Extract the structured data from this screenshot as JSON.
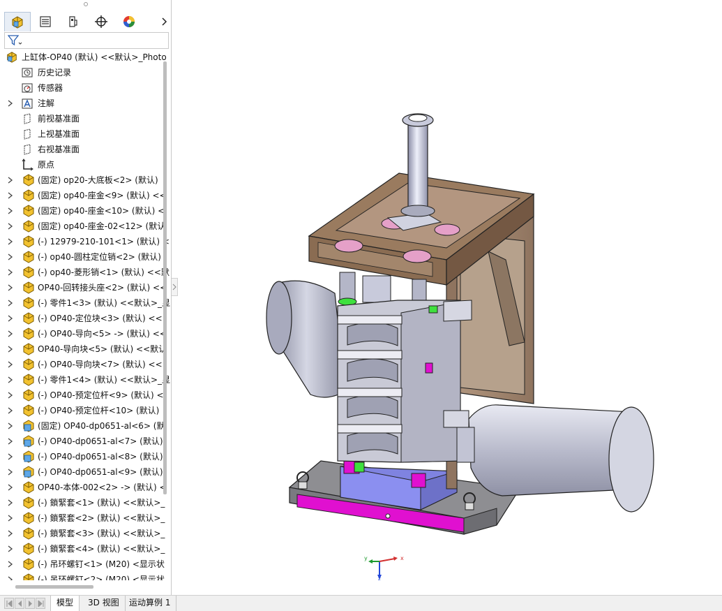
{
  "tree": {
    "root": "上缸体-OP40 (默认) <<默认>_Photo",
    "items": [
      {
        "label": "历史记录",
        "icon": "history-icon",
        "arrow": false
      },
      {
        "label": "传感器",
        "icon": "sensor-icon",
        "arrow": false
      },
      {
        "label": "注解",
        "icon": "annotation-icon",
        "arrow": true
      },
      {
        "label": "前视基准面",
        "icon": "plane-icon",
        "arrow": false
      },
      {
        "label": "上视基准面",
        "icon": "plane-icon",
        "arrow": false
      },
      {
        "label": "右视基准面",
        "icon": "plane-icon",
        "arrow": false
      },
      {
        "label": "原点",
        "icon": "origin-icon",
        "arrow": false
      },
      {
        "label": "(固定) op20-大底板<2> (默认)",
        "icon": "part-icon",
        "arrow": true
      },
      {
        "label": "(固定) op40-座金<9> (默认) <<",
        "icon": "part-icon",
        "arrow": true
      },
      {
        "label": "(固定) op40-座金<10> (默认) <",
        "icon": "part-icon",
        "arrow": true
      },
      {
        "label": "(固定) op40-座金-02<12> (默认",
        "icon": "part-icon",
        "arrow": true
      },
      {
        "label": "(-) 12979-210-101<1> (默认) <",
        "icon": "part-icon",
        "arrow": true
      },
      {
        "label": "(-) op40-圆柱定位销<2> (默认)",
        "icon": "part-icon",
        "arrow": true
      },
      {
        "label": "(-) op40-菱形销<1> (默认) <<默",
        "icon": "part-icon",
        "arrow": true
      },
      {
        "label": "OP40-回转接头座<2> (默认) <<",
        "icon": "part-icon",
        "arrow": true
      },
      {
        "label": "(-) 零件1<3> (默认) <<默认>_显",
        "icon": "part-icon",
        "arrow": true
      },
      {
        "label": "(-) OP40-定位块<3> (默认) <<",
        "icon": "part-icon",
        "arrow": true
      },
      {
        "label": "(-) OP40-导向<5> -> (默认) <<",
        "icon": "part-icon",
        "arrow": true
      },
      {
        "label": "OP40-导向块<5> (默认) <<默认",
        "icon": "part-icon",
        "arrow": true
      },
      {
        "label": "(-) OP40-导向块<7> (默认) <<",
        "icon": "part-icon",
        "arrow": true
      },
      {
        "label": "(-) 零件1<4> (默认) <<默认>_显",
        "icon": "part-icon",
        "arrow": true
      },
      {
        "label": "(-) OP40-预定位杆<9> (默认) <",
        "icon": "part-icon",
        "arrow": true
      },
      {
        "label": "(-) OP40-预定位杆<10> (默认)",
        "icon": "part-icon",
        "arrow": true
      },
      {
        "label": "(固定) OP40-dp0651-al<6> (默",
        "icon": "assembly-icon",
        "arrow": true
      },
      {
        "label": "(-) OP40-dp0651-al<7> (默认)",
        "icon": "assembly-icon",
        "arrow": true
      },
      {
        "label": "(-) OP40-dp0651-al<8> (默认)",
        "icon": "assembly-icon",
        "arrow": true
      },
      {
        "label": "(-) OP40-dp0651-al<9> (默认)",
        "icon": "assembly-icon",
        "arrow": true
      },
      {
        "label": "OP40-本体-002<2> -> (默认) <",
        "icon": "part-icon",
        "arrow": true
      },
      {
        "label": "(-) 鎖緊套<1> (默认) <<默认>_",
        "icon": "part-icon",
        "arrow": true
      },
      {
        "label": "(-) 鎖緊套<2> (默认) <<默认>_",
        "icon": "part-icon",
        "arrow": true
      },
      {
        "label": "(-) 鎖緊套<3> (默认) <<默认>_",
        "icon": "part-icon",
        "arrow": true
      },
      {
        "label": "(-) 鎖緊套<4> (默认) <<默认>_",
        "icon": "part-icon",
        "arrow": true
      },
      {
        "label": "(-) 吊环螺钉<1> (M20) <显示状",
        "icon": "part-icon",
        "arrow": true
      },
      {
        "label": "(-) 吊环螺钉<2> (M20) <显示状",
        "icon": "part-icon",
        "arrow": true
      }
    ]
  },
  "bottom_tabs": [
    "模型",
    "3D 视图",
    "运动算例 1"
  ],
  "triad": {
    "x": "x",
    "y": "y",
    "z": "z"
  },
  "colors": {
    "part": "#f2c230",
    "assembly": "#5fa8e8",
    "magenta": "#e010d0",
    "brown": "#9a7b5f",
    "steel": "#c7c9d6"
  }
}
